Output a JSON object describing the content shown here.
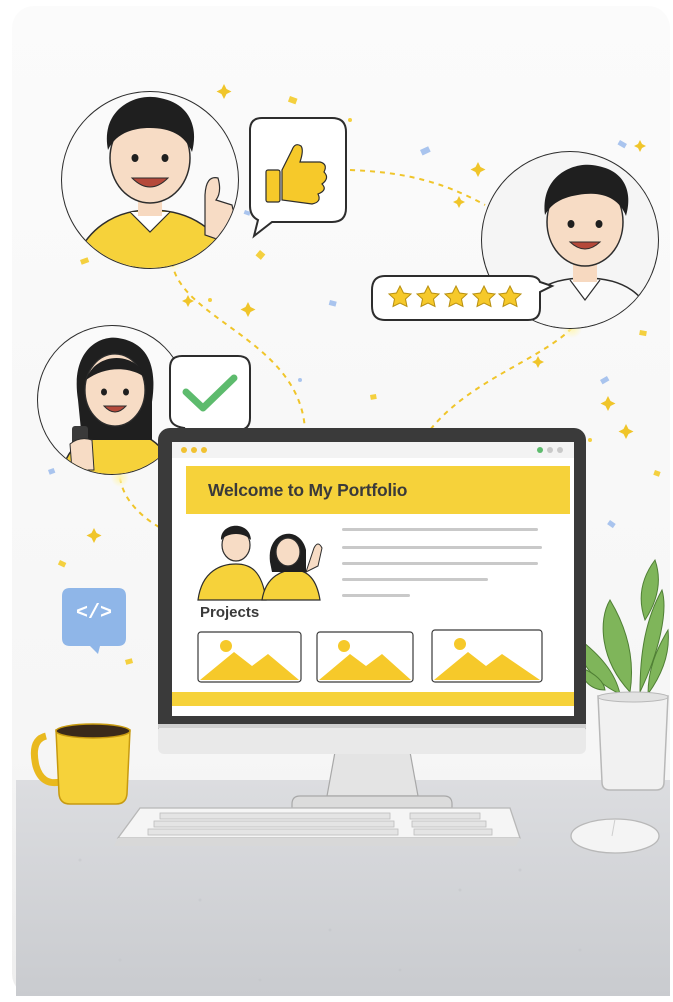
{
  "portfolio_site": {
    "hero_title": "Welcome to My Portfolio",
    "projects_heading": "Projects",
    "project_cards": [
      "image-placeholder",
      "image-placeholder",
      "image-placeholder"
    ]
  },
  "badges": {
    "code_badge": "</>"
  },
  "feedback": [
    {
      "who": "young man in yellow shirt",
      "reaction": "thumbs-up-icon"
    },
    {
      "who": "man in white shirt",
      "reaction": "five-star-rating",
      "rating": 5,
      "max_rating": 5
    },
    {
      "who": "woman with phone",
      "reaction": "check-icon"
    }
  ],
  "colors": {
    "accent_yellow": "#f6d23a",
    "check_green": "#5dbb6d",
    "code_blue": "#8fb6e8",
    "monitor_frame": "#3a3a3a",
    "desk_gray": "#d4d6d9",
    "plant_green": "#7fb55a"
  }
}
